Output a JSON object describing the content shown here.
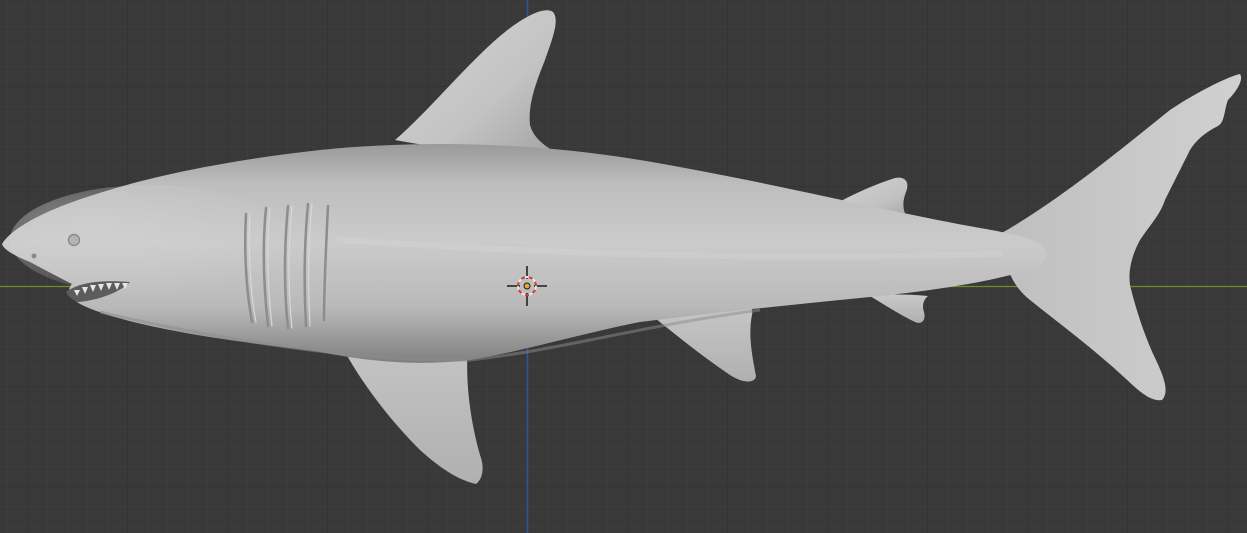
{
  "viewport": {
    "background_color": "#393939",
    "grid_minor_color": "#404040",
    "grid_major_color": "#2f2f2f",
    "x_axis_color": "#6c8e28",
    "y_axis_color": "#2f55a8",
    "view": "orthographic-side"
  },
  "object": {
    "type": "mesh",
    "shading": "solid",
    "depicts": "shark",
    "base_color": "#c9c9c9"
  },
  "cursor": {
    "icon": "3d-cursor-icon",
    "ring_colors": [
      "#e8e8e8",
      "#d23a3a"
    ]
  },
  "origin": {
    "icon": "object-origin-dot",
    "color": "#e8a33a"
  }
}
